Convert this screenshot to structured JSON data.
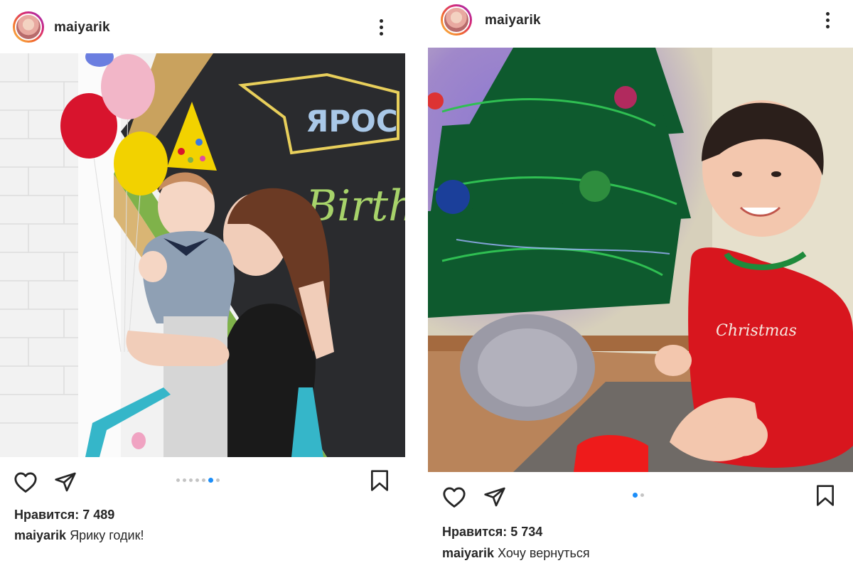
{
  "posts": [
    {
      "username": "maiyarik",
      "likes_label": "Нравится: 7 489",
      "caption_user": "maiyarik",
      "caption_text": "Ярику годик!",
      "photo_sign": "ЯРОС",
      "photo_sign_script": "Birth",
      "carousel_total": 7,
      "carousel_active": 6,
      "colors": {
        "active_dot": "#1c8ef9",
        "inactive_dot": "#c4c4c4",
        "text": "#262626"
      }
    },
    {
      "username": "maiyarik",
      "likes_label": "Нравится: 5 734",
      "caption_user": "maiyarik",
      "caption_text": "Хочу вернуться",
      "photo_shirt_text": "Christmas",
      "carousel_total": 2,
      "carousel_active": 1,
      "colors": {
        "active_dot": "#1c8ef9",
        "inactive_dot": "#c4c4c4",
        "text": "#262626"
      }
    }
  ],
  "icons": [
    "heart-icon",
    "share-icon",
    "bookmark-icon",
    "more-icon"
  ]
}
